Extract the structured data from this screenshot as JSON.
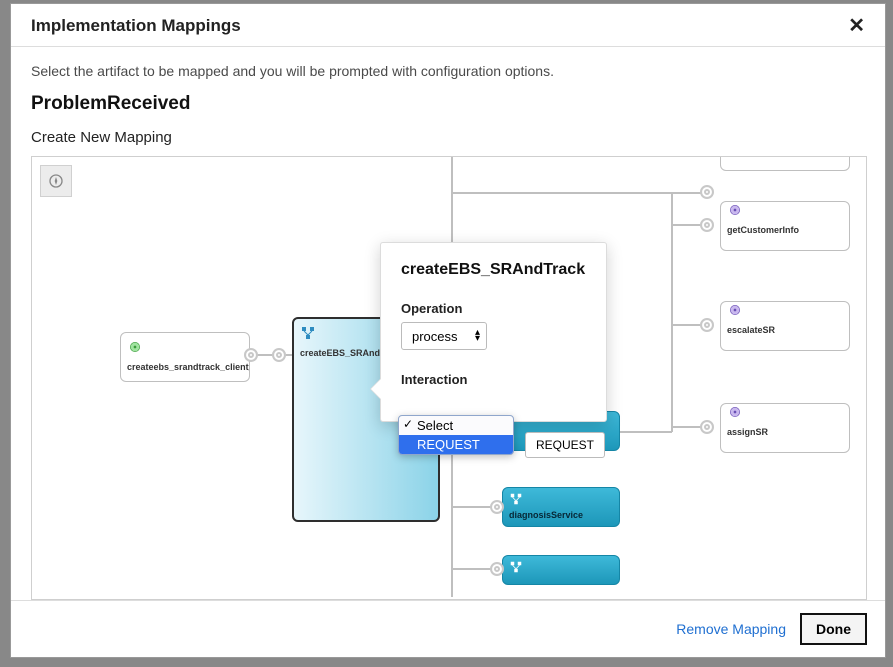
{
  "header": {
    "title": "Implementation Mappings",
    "close_label": "✕"
  },
  "body": {
    "subtitle": "Select the artifact to be mapped and you will be prompted with configuration options.",
    "heading": "ProblemReceived",
    "subheading": "Create New Mapping"
  },
  "canvas": {
    "compass_icon": "compass-icon",
    "client_ep": {
      "label": "createebs_srandtrack_client_ep"
    },
    "create_node": {
      "label": "createEBS_SRAnd"
    },
    "diagnosis": {
      "label": "diagnosisService"
    },
    "svc": {
      "getCustomer": "getCustomerInfo",
      "escalate": "escalateSR",
      "assign": "assignSR"
    }
  },
  "popover": {
    "title": "createEBS_SRAndTrack",
    "operation_label": "Operation",
    "operation_value": "process",
    "interaction_label": "Interaction",
    "interaction_pill": "REQUEST",
    "dropdown": {
      "opt_select": "Select",
      "opt_request": "REQUEST"
    }
  },
  "footer": {
    "remove": "Remove Mapping",
    "done": "Done"
  }
}
